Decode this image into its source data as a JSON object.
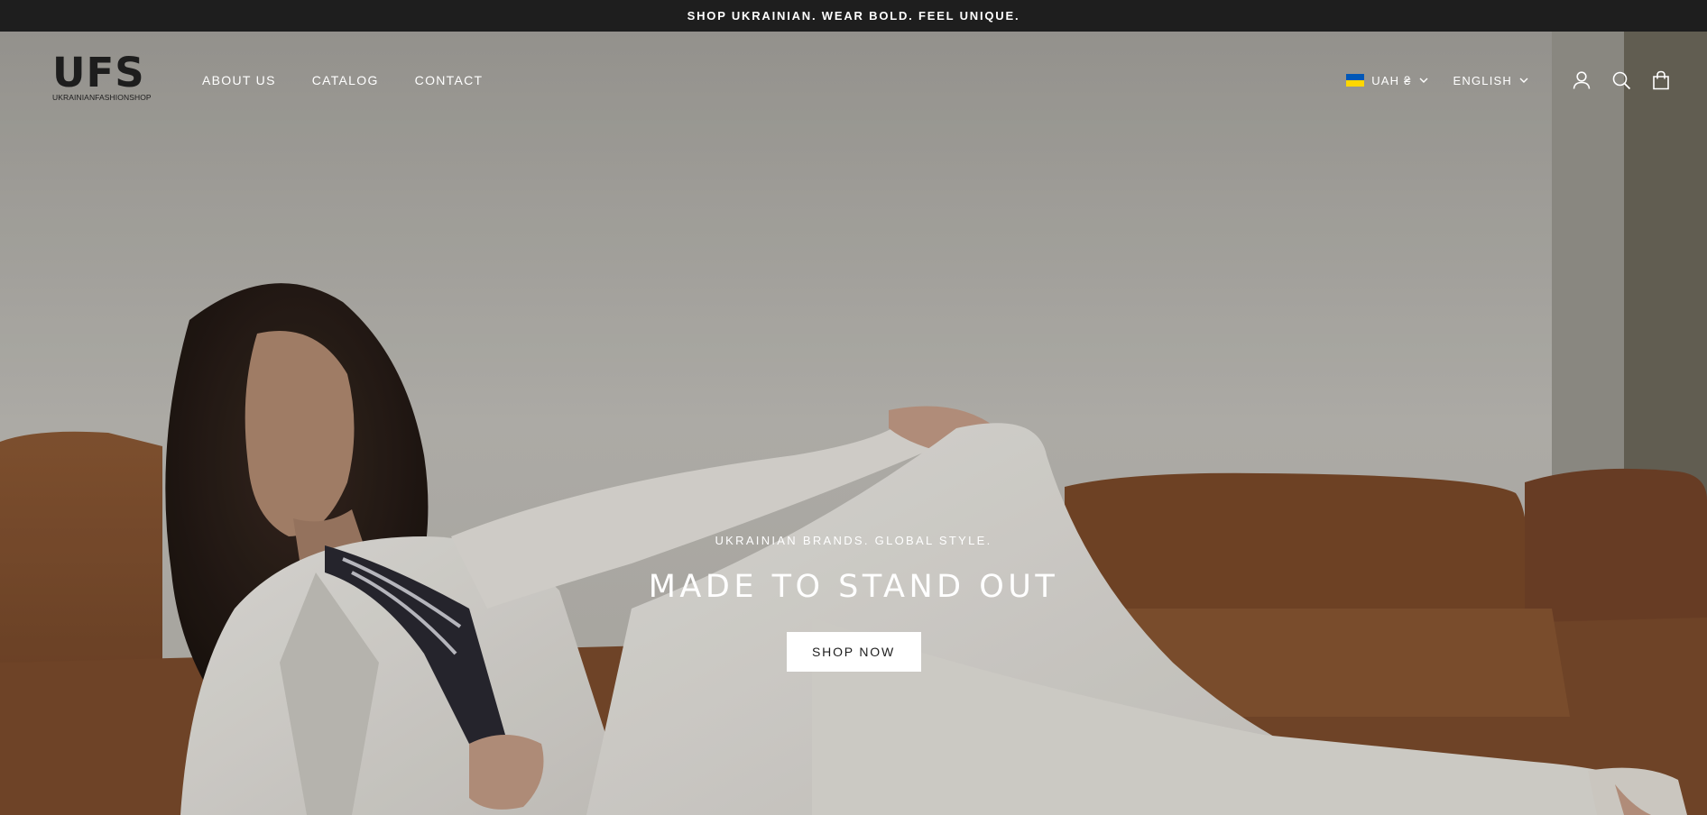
{
  "announcement": {
    "text": "SHOP UKRAINIAN. WEAR BOLD. FEEL UNIQUE."
  },
  "header": {
    "logo_main": "UFS",
    "logo_sub": "UKRAINIANFASHIONSHOP",
    "nav": [
      {
        "label": "ABOUT US"
      },
      {
        "label": "CATALOG"
      },
      {
        "label": "CONTACT"
      }
    ],
    "currency": "UAH ₴",
    "language": "ENGLISH",
    "icons": [
      "account-icon",
      "search-icon",
      "cart-icon"
    ]
  },
  "hero": {
    "eyebrow": "UKRAINIAN BRANDS. GLOBAL STYLE.",
    "headline": "MADE TO STAND OUT",
    "cta_label": "SHOP NOW"
  },
  "colors": {
    "announcement_bg": "#1e1e1e",
    "text_light": "#ffffff",
    "text_dark": "#1d1d1d",
    "flag_blue": "#0057b7",
    "flag_yellow": "#ffd700"
  }
}
